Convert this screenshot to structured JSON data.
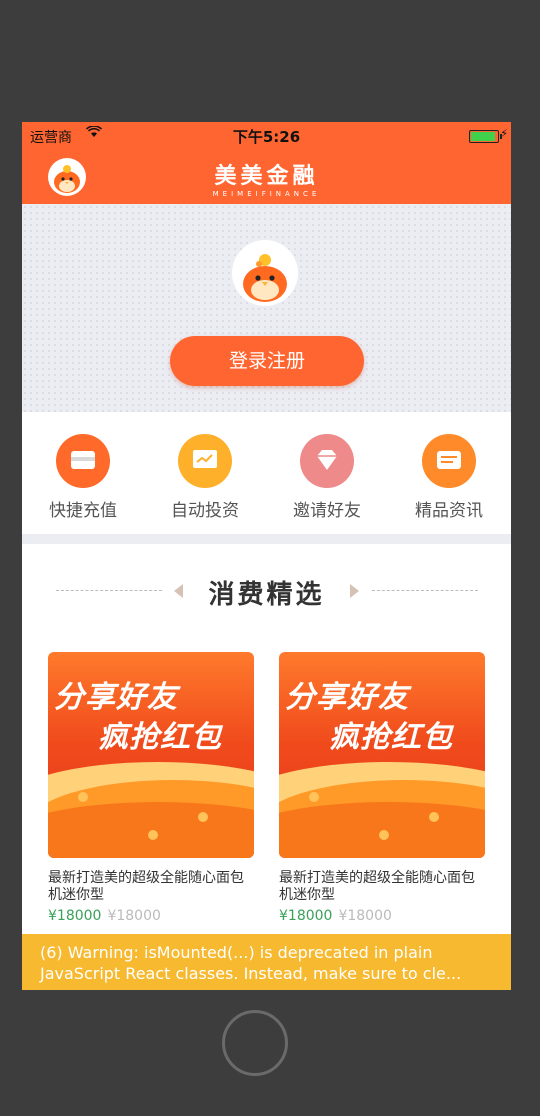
{
  "status_bar": {
    "carrier": "运营商",
    "wifi_icon": "wifi-icon",
    "time": "下午5:26",
    "battery_icon": "battery-icon"
  },
  "navbar": {
    "brand_cn": "美美金融",
    "brand_en": "MEIMEIFINANCE",
    "avatar_icon": "mascot-avatar-icon"
  },
  "hero": {
    "avatar_icon": "mascot-avatar-icon",
    "login_label": "登录注册"
  },
  "quick_actions": [
    {
      "label": "快捷充值",
      "icon": "card-icon",
      "color": "#ff6a2a"
    },
    {
      "label": "自动投资",
      "icon": "screen-icon",
      "color": "#ffb02a"
    },
    {
      "label": "邀请好友",
      "icon": "diamond-icon",
      "color": "#ee8a8a"
    },
    {
      "label": "精品资讯",
      "icon": "message-icon",
      "color": "#ff8a2a"
    }
  ],
  "section": {
    "title": "消费精选"
  },
  "products": [
    {
      "banner_line1": "分享好友",
      "banner_line2": "疯抢红包",
      "name": "最新打造美的超级全能随心面包机迷你型",
      "price": "¥18000",
      "old_price": "¥18000"
    },
    {
      "banner_line1": "分享好友",
      "banner_line2": "疯抢红包",
      "name": "最新打造美的超级全能随心面包机迷你型",
      "price": "¥18000",
      "old_price": "¥18000"
    }
  ],
  "warning": {
    "line1": "(6) Warning: isMounted(...) is deprecated in plain",
    "line2": "JavaScript React classes. Instead, make sure to cle..."
  },
  "colors": {
    "brand": "#ff6530",
    "price": "#3aa05a",
    "warning": "#f6b92f"
  }
}
